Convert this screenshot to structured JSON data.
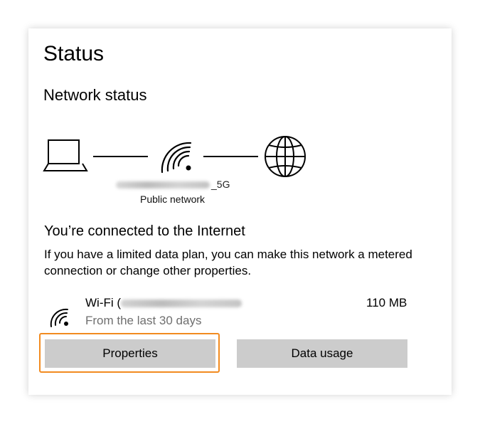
{
  "page": {
    "title": "Status",
    "section_title": "Network status"
  },
  "network": {
    "name_suffix": "_5G",
    "type": "Public network"
  },
  "connection": {
    "status": "You’re connected to the Internet",
    "description": "If you have a limited data plan, you can make this network a metered connection or change other properties."
  },
  "wifi": {
    "prefix": "Wi-Fi (",
    "period": "From the last 30 days",
    "usage": "110 MB"
  },
  "buttons": {
    "properties": "Properties",
    "data_usage": "Data usage"
  },
  "colors": {
    "highlight": "#f28b20",
    "button_bg": "#cccccc",
    "secondary_text": "#6f6f6f"
  },
  "icons": [
    "laptop-icon",
    "wifi-icon",
    "globe-icon"
  ]
}
